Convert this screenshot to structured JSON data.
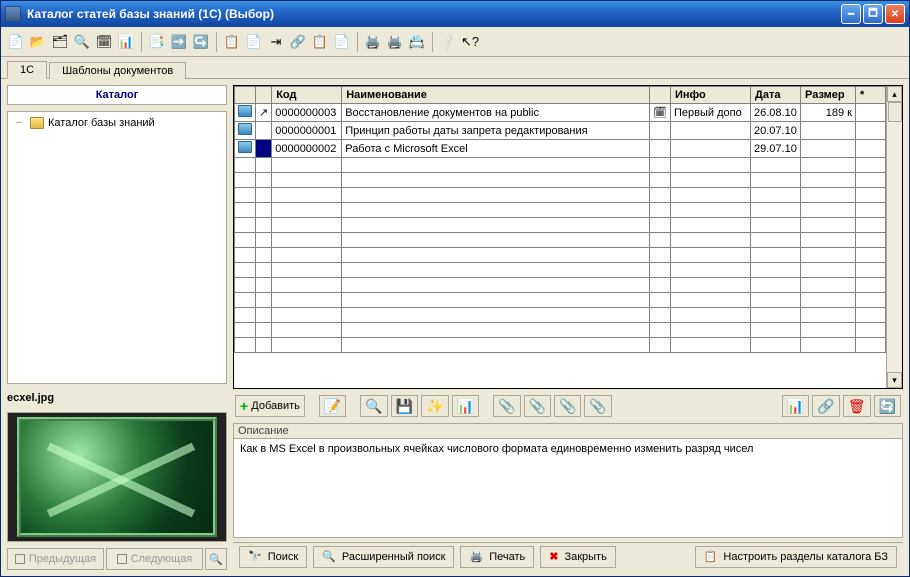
{
  "window": {
    "title": "Каталог статей базы знаний (1С) (Выбор)"
  },
  "tabs": [
    {
      "label": "1С",
      "active": true
    },
    {
      "label": "Шаблоны документов",
      "active": false
    }
  ],
  "catalog": {
    "header": "Каталог",
    "root_label": "Каталог базы знаний"
  },
  "preview": {
    "filename": "ecxel.jpg"
  },
  "nav": {
    "prev": "Предыдущая",
    "next": "Следующая"
  },
  "grid": {
    "columns": [
      "",
      "",
      "Код",
      "Наименование",
      "",
      "Инфо",
      "Дата",
      "Размер",
      "*"
    ],
    "rows": [
      {
        "code": "0000000003",
        "name": "Восстановление документов на public",
        "flag": true,
        "info": "Первый допо",
        "date": "26.08.10",
        "size": "189 к",
        "selected": false
      },
      {
        "code": "0000000001",
        "name": "Принцип работы даты запрета редактирования",
        "flag": false,
        "info": "",
        "date": "20.07.10",
        "size": "",
        "selected": false
      },
      {
        "code": "0000000002",
        "name": "Работа с Microsoft Excel",
        "flag": false,
        "info": "",
        "date": "29.07.10",
        "size": "",
        "selected": true
      }
    ]
  },
  "mid_toolbar": {
    "add": "Добавить"
  },
  "description": {
    "label": "Описание",
    "text": "Как в MS Excel в произвольных ячейках числового формата единовременно изменить разряд чисел"
  },
  "bottom": {
    "search": "Поиск",
    "adv_search": "Расширенный поиск",
    "print": "Печать",
    "close": "Закрыть",
    "config": "Настроить разделы каталога БЗ"
  }
}
